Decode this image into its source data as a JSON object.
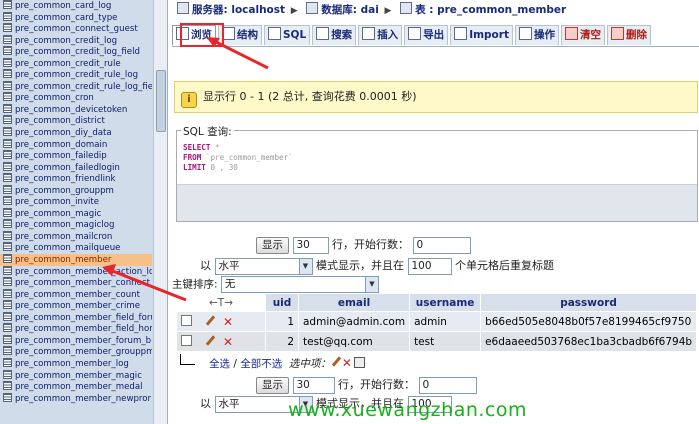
{
  "sidebar": {
    "tables": [
      "pre_common_card_log",
      "pre_common_card_type",
      "pre_common_connect_guest",
      "pre_common_credit_log",
      "pre_common_credit_log_field",
      "pre_common_credit_rule",
      "pre_common_credit_rule_log",
      "pre_common_credit_rule_log_fie",
      "pre_common_cron",
      "pre_common_devicetoken",
      "pre_common_district",
      "pre_common_diy_data",
      "pre_common_domain",
      "pre_common_failedip",
      "pre_common_failedlogin",
      "pre_common_friendlink",
      "pre_common_grouppm",
      "pre_common_invite",
      "pre_common_magic",
      "pre_common_magiclog",
      "pre_common_mailcron",
      "pre_common_mailqueue",
      "pre_common_member",
      "pre_common_member_action_lo",
      "pre_common_member_connect",
      "pre_common_member_count",
      "pre_common_member_crime",
      "pre_common_member_field_foru",
      "pre_common_member_field_hom",
      "pre_common_member_forum_b",
      "pre_common_member_grouppm",
      "pre_common_member_log",
      "pre_common_member_magic",
      "pre_common_member_medal",
      "pre_common_member_newpror"
    ],
    "selected_index": 22
  },
  "breadcrumb": {
    "server_label": "服务器: localhost",
    "db_label": "数据库: dai",
    "table_label": "表 : pre_common_member"
  },
  "tabs": [
    "浏览",
    "结构",
    "SQL",
    "搜索",
    "插入",
    "导出",
    "Import",
    "操作",
    "清空",
    "删除"
  ],
  "notice": {
    "text": "显示行 0 - 1 (2 总计, 查询花费 0.0001 秒)"
  },
  "sql": {
    "legend": "SQL 查询:",
    "line1_kw": "SELECT",
    "line1_rest": " *",
    "line2_kw": "FROM",
    "line2_rest": " `pre_common_member`",
    "line3_kw": "LIMIT",
    "line3_rest": " 0 , 30"
  },
  "controls_top": {
    "show_button": "显示",
    "rows_value": "30",
    "start_label": "行，开始行数：",
    "start_value": "0",
    "mode_prefix": "以",
    "mode_value": "水平",
    "mode_suffix": "模式显示，并且在",
    "repeat_value": "100",
    "repeat_suffix": "个单元格后重复标题"
  },
  "sort": {
    "label": "主键排序:",
    "value": "无"
  },
  "grid": {
    "columns": [
      "uid",
      "email",
      "username",
      "password"
    ],
    "rows": [
      {
        "uid": "1",
        "email": "admin@admin.com",
        "username": "admin",
        "password": "b66ed505e8048b0f57e8199465cf9750"
      },
      {
        "uid": "2",
        "email": "test@qq.com",
        "username": "test",
        "password": "e6daaeed503768ec1ba3cbadb6f6794b"
      }
    ]
  },
  "bulk": {
    "select_all": "全选",
    "slash": " / ",
    "deselect_all": "全部不选",
    "with_selected": "选中项："
  },
  "controls_bottom": {
    "show_button": "显示",
    "rows_value": "30",
    "start_label": "行，开始行数：",
    "start_value": "0",
    "mode_prefix": "以",
    "mode_value": "水平",
    "mode_suffix": "模式显示，并且在",
    "repeat_value": "100",
    "repeat_suffix": "个单元格后重复标题"
  },
  "watermark": "www.xuewangzhan.com",
  "colors": {
    "sidebar_bg": "#d0dce9",
    "selected_bg": "#f6c187",
    "notice_bg": "#fff8c8",
    "header_bg": "#d6dfea",
    "annotation_red": "#e8262a",
    "watermark": "#18b01b"
  }
}
